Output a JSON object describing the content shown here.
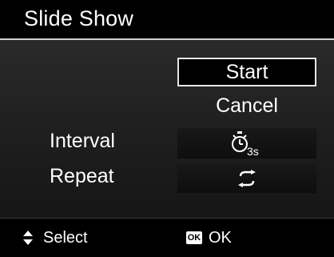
{
  "header": {
    "title": "Slide Show"
  },
  "menu": {
    "options": {
      "start": "Start",
      "cancel": "Cancel"
    },
    "settings": [
      {
        "label": "Interval",
        "icon": "interval-3s-icon",
        "icon_text": "3s"
      },
      {
        "label": "Repeat",
        "icon": "repeat-icon"
      }
    ]
  },
  "footer": {
    "select_label": "Select",
    "ok_badge": "OK",
    "ok_label": "OK"
  },
  "colors": {
    "background": "#000000",
    "selection_border": "#e6e6e6",
    "text": "#ffffff"
  }
}
